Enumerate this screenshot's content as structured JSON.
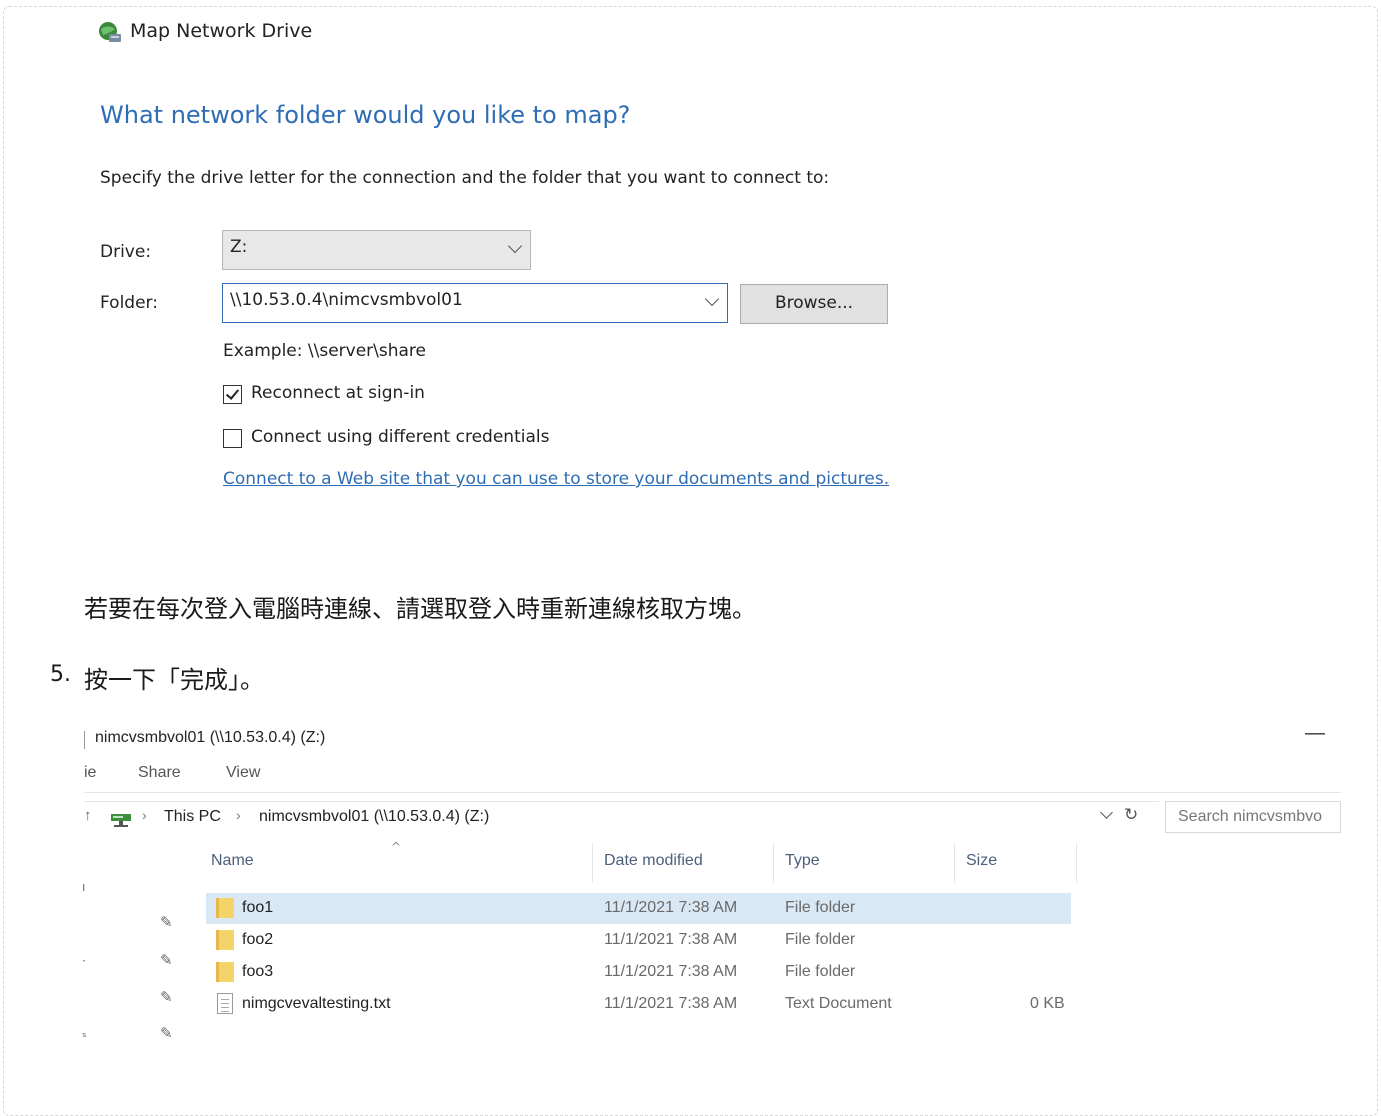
{
  "dialog": {
    "title": "Map Network Drive",
    "heading": "What network folder would you like to map?",
    "instruction": "Specify the drive letter for the connection and the folder that you want to connect to:",
    "drive_label": "Drive:",
    "drive_value": "Z:",
    "folder_label": "Folder:",
    "folder_value": "\\\\10.53.0.4\\nimcvsmbvol01",
    "browse_label": "Browse...",
    "example": "Example: \\\\server\\share",
    "reconnect_label": "Reconnect at sign-in",
    "reconnect_checked": true,
    "credentials_label": "Connect using different credentials",
    "credentials_checked": false,
    "web_link": "Connect to a Web site that you can use to store your documents and pictures."
  },
  "doc_text": {
    "note": "若要在每次登入電腦時連線、請選取登入時重新連線核取方塊。",
    "step_number": "5.",
    "step_text": "按一下「完成」。"
  },
  "explorer": {
    "title": "nimcvsmbvol01 (\\\\10.53.0.4) (Z:)",
    "minimize": "—",
    "ribbon_tabs": [
      "ie",
      "Share",
      "View"
    ],
    "breadcrumb": [
      "This PC",
      "nimcvsmbvol01 (\\\\10.53.0.4) (Z:)"
    ],
    "search_placeholder": "Search nimcvsmbvo",
    "columns": [
      "Name",
      "Date modified",
      "Type",
      "Size"
    ],
    "rows": [
      {
        "name": "foo1",
        "date": "11/1/2021 7:38 AM",
        "type": "File folder",
        "size": "",
        "icon": "folder-icon",
        "selected": true
      },
      {
        "name": "foo2",
        "date": "11/1/2021 7:38 AM",
        "type": "File folder",
        "size": "",
        "icon": "folder-icon",
        "selected": false
      },
      {
        "name": "foo3",
        "date": "11/1/2021 7:38 AM",
        "type": "File folder",
        "size": "",
        "icon": "folder-icon",
        "selected": false
      },
      {
        "name": "nimgcvevaltesting.txt",
        "date": "11/1/2021 7:38 AM",
        "type": "Text Document",
        "size": "0 KB",
        "icon": "text-file-icon",
        "selected": false
      }
    ]
  }
}
